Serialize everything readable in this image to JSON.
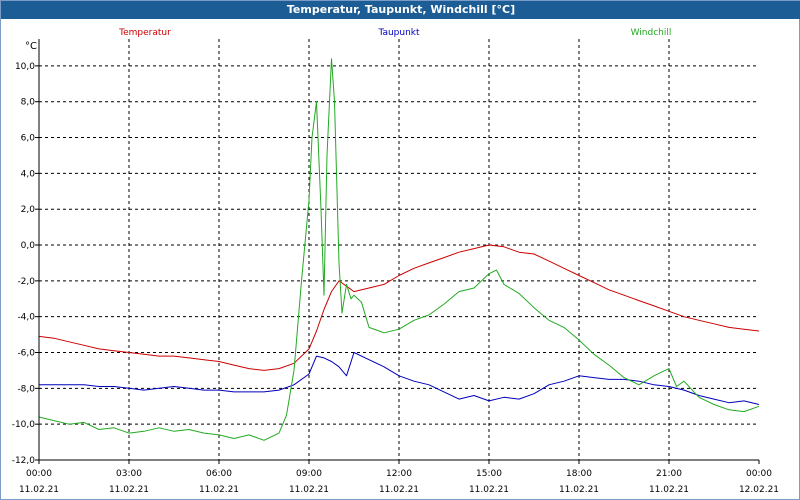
{
  "window": {
    "title": "Temperatur, Taupunkt, Windchill [°C]"
  },
  "chart_data": {
    "type": "line",
    "title": "Temperatur, Taupunkt, Windchill [°C]",
    "ylabel": "°C",
    "xlabel": "",
    "ylim": [
      -12,
      11.5
    ],
    "y_ticks": [
      -12,
      -10,
      -8,
      -6,
      -4,
      -2,
      0,
      2,
      4,
      6,
      8,
      10
    ],
    "y_tick_labels": [
      "-12,0",
      "-10,0",
      "-8,0",
      "-6,0",
      "-4,0",
      "-2,0",
      "0,0",
      "2,0",
      "4,0",
      "6,0",
      "8,0",
      "10,0"
    ],
    "xlim": [
      0,
      24
    ],
    "x_ticks": [
      0,
      3,
      6,
      9,
      12,
      15,
      18,
      21,
      24
    ],
    "x_tick_times": [
      "00:00",
      "03:00",
      "06:00",
      "09:00",
      "12:00",
      "15:00",
      "18:00",
      "21:00",
      "00:00"
    ],
    "x_tick_dates": [
      "11.02.21",
      "11.02.21",
      "11.02.21",
      "11.02.21",
      "11.02.21",
      "11.02.21",
      "11.02.21",
      "11.02.21",
      "12.02.21"
    ],
    "grid": true,
    "legend_placement": "top",
    "series": [
      {
        "name": "Temperatur",
        "color": "#cc0000",
        "x": [
          0,
          0.5,
          1,
          1.5,
          2,
          2.5,
          3,
          3.5,
          4,
          4.5,
          5,
          5.5,
          6,
          6.5,
          7,
          7.5,
          8,
          8.5,
          9,
          9.25,
          9.5,
          9.75,
          10,
          10.25,
          10.5,
          11,
          11.5,
          12,
          12.5,
          13,
          13.5,
          14,
          14.5,
          15,
          15.5,
          16,
          16.5,
          17,
          17.5,
          18,
          18.5,
          19,
          19.5,
          20,
          20.5,
          21,
          21.5,
          22,
          22.5,
          23,
          23.5,
          24
        ],
        "values": [
          -5.1,
          -5.2,
          -5.4,
          -5.6,
          -5.8,
          -5.9,
          -6.0,
          -6.1,
          -6.2,
          -6.2,
          -6.3,
          -6.4,
          -6.5,
          -6.7,
          -6.9,
          -7.0,
          -6.9,
          -6.6,
          -5.8,
          -4.8,
          -3.6,
          -2.6,
          -2.0,
          -2.3,
          -2.6,
          -2.4,
          -2.2,
          -1.7,
          -1.3,
          -1.0,
          -0.7,
          -0.4,
          -0.2,
          0.0,
          -0.1,
          -0.4,
          -0.5,
          -0.9,
          -1.3,
          -1.7,
          -2.1,
          -2.5,
          -2.8,
          -3.1,
          -3.4,
          -3.7,
          -4.0,
          -4.2,
          -4.4,
          -4.6,
          -4.7,
          -4.8
        ]
      },
      {
        "name": "Taupunkt",
        "color": "#0000bb",
        "x": [
          0,
          0.5,
          1,
          1.5,
          2,
          2.5,
          3,
          3.5,
          4,
          4.5,
          5,
          5.5,
          6,
          6.5,
          7,
          7.5,
          8,
          8.5,
          9,
          9.25,
          9.5,
          9.75,
          10,
          10.25,
          10.5,
          11,
          11.5,
          12,
          12.5,
          13,
          13.5,
          14,
          14.5,
          15,
          15.5,
          16,
          16.5,
          17,
          17.5,
          18,
          18.5,
          19,
          19.5,
          20,
          20.5,
          21,
          21.5,
          22,
          22.5,
          23,
          23.5,
          24
        ],
        "values": [
          -7.8,
          -7.8,
          -7.8,
          -7.8,
          -7.9,
          -7.9,
          -8.0,
          -8.1,
          -8.0,
          -7.9,
          -8.0,
          -8.1,
          -8.1,
          -8.2,
          -8.2,
          -8.2,
          -8.1,
          -7.8,
          -7.2,
          -6.2,
          -6.3,
          -6.5,
          -6.8,
          -7.3,
          -6.0,
          -6.4,
          -6.8,
          -7.3,
          -7.6,
          -7.8,
          -8.2,
          -8.6,
          -8.4,
          -8.7,
          -8.5,
          -8.6,
          -8.3,
          -7.8,
          -7.6,
          -7.3,
          -7.4,
          -7.5,
          -7.5,
          -7.6,
          -7.8,
          -7.9,
          -8.1,
          -8.4,
          -8.6,
          -8.8,
          -8.7,
          -8.9
        ]
      },
      {
        "name": "Windchill",
        "color": "#22aa22",
        "x": [
          0,
          0.5,
          1,
          1.5,
          2,
          2.5,
          3,
          3.5,
          4,
          4.5,
          5,
          5.5,
          6,
          6.5,
          7,
          7.5,
          8,
          8.25,
          8.5,
          8.75,
          9,
          9.1,
          9.25,
          9.4,
          9.5,
          9.6,
          9.75,
          9.85,
          10,
          10.1,
          10.25,
          10.4,
          10.5,
          10.75,
          11,
          11.5,
          12,
          12.5,
          13,
          13.5,
          14,
          14.5,
          15,
          15.25,
          15.5,
          16,
          16.5,
          17,
          17.5,
          18,
          18.5,
          19,
          19.5,
          20,
          20.5,
          21,
          21.25,
          21.5,
          22,
          22.5,
          23,
          23.5,
          24
        ],
        "values": [
          -9.6,
          -9.8,
          -10.0,
          -9.9,
          -10.3,
          -10.2,
          -10.5,
          -10.4,
          -10.2,
          -10.4,
          -10.3,
          -10.5,
          -10.6,
          -10.8,
          -10.6,
          -10.9,
          -10.5,
          -9.5,
          -7.0,
          -2.0,
          2.5,
          6.0,
          8.0,
          2.0,
          -2.8,
          5.0,
          10.4,
          8.0,
          -1.0,
          -3.8,
          -2.2,
          -3.0,
          -2.8,
          -3.2,
          -4.6,
          -4.9,
          -4.7,
          -4.2,
          -3.9,
          -3.3,
          -2.6,
          -2.4,
          -1.6,
          -1.4,
          -2.2,
          -2.7,
          -3.5,
          -4.2,
          -4.6,
          -5.3,
          -6.1,
          -6.7,
          -7.4,
          -7.8,
          -7.3,
          -6.9,
          -7.9,
          -7.6,
          -8.5,
          -8.9,
          -9.2,
          -9.3,
          -9.0
        ]
      }
    ]
  }
}
